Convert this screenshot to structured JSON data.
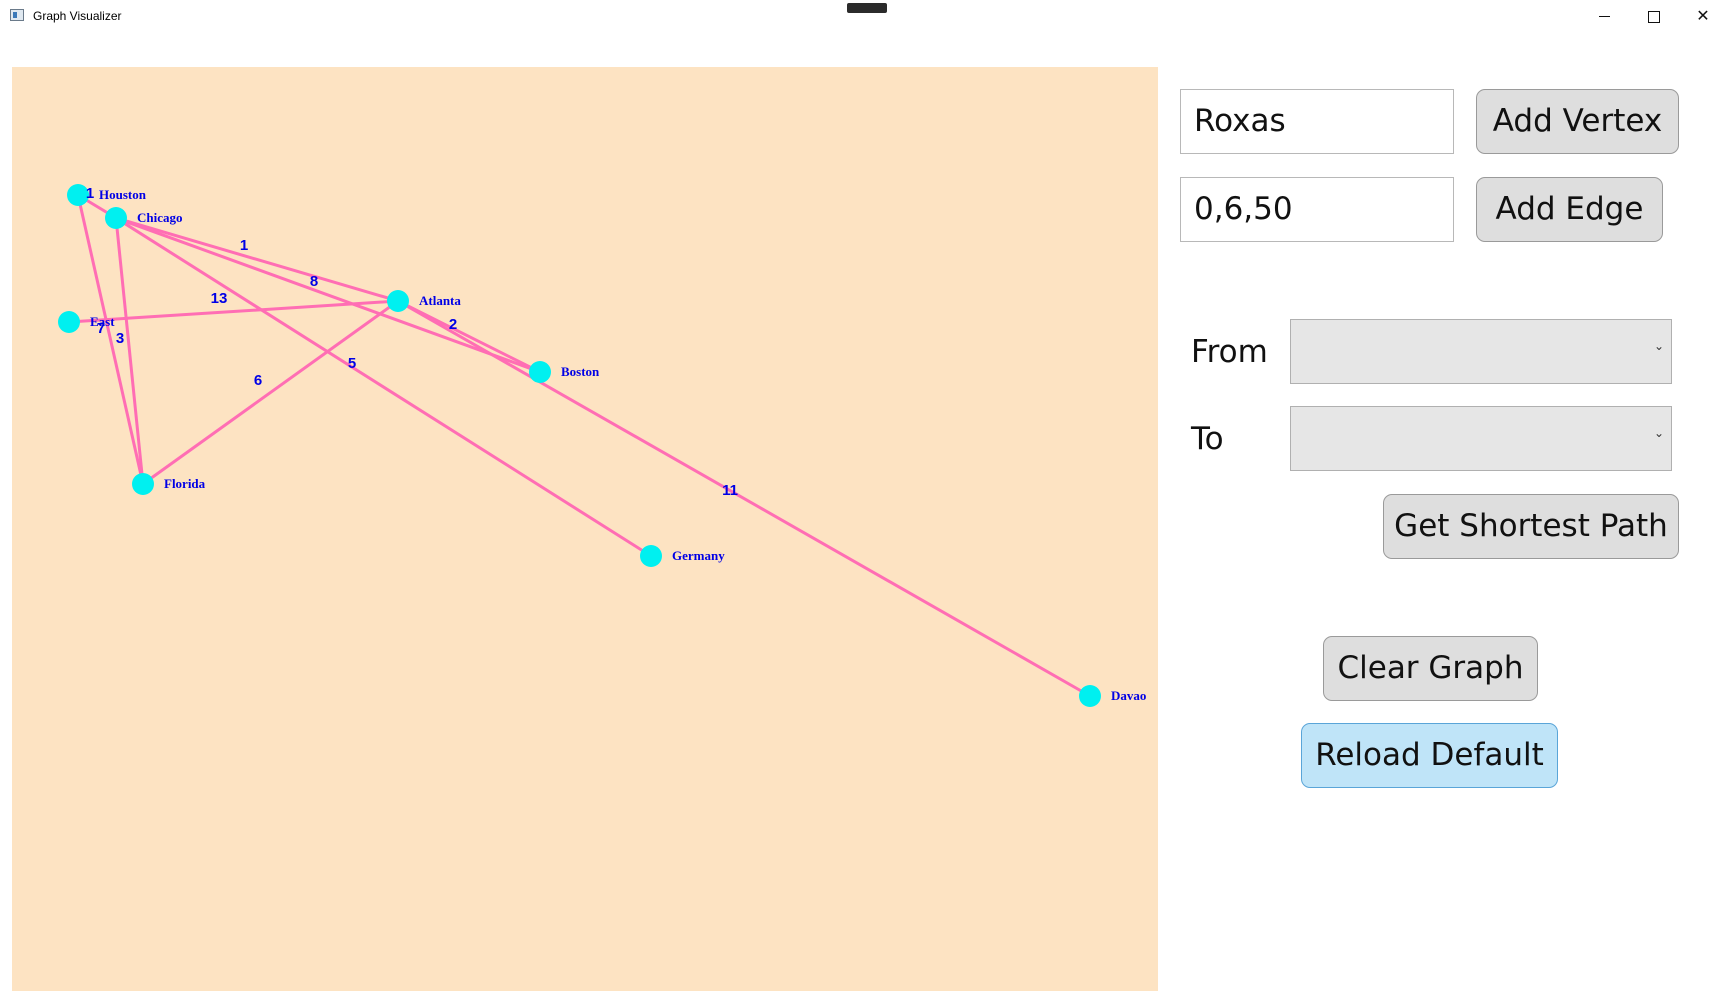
{
  "window": {
    "title": "Graph Visualizer",
    "controls": {
      "minimize": "minimize-icon",
      "maximize": "maximize-icon",
      "close": "close-icon"
    }
  },
  "colors": {
    "canvas_bg": "#fde3c2",
    "edge": "#ff6eb4",
    "vertex": "#00f0f0",
    "label": "#0000e6",
    "button_bg": "#dedede",
    "button_hover_bg": "#bfe4f8"
  },
  "graph": {
    "vertices": [
      "Houston",
      "Chicago",
      "Atlanta",
      "East",
      "Boston",
      "Florida",
      "Germany",
      "Davao"
    ],
    "edges": [
      {
        "from": "Houston",
        "to": "Chicago",
        "weight": "1"
      },
      {
        "from": "Chicago",
        "to": "Atlanta",
        "weight": "1"
      },
      {
        "from": "Chicago",
        "to": "Boston",
        "weight": "8"
      },
      {
        "from": "East",
        "to": "Atlanta",
        "weight": "13"
      },
      {
        "from": "Atlanta",
        "to": "Boston",
        "weight": "2"
      },
      {
        "from": "Houston",
        "to": "Florida",
        "weight": "7"
      },
      {
        "from": "Chicago",
        "to": "Florida",
        "weight": "3"
      },
      {
        "from": "Florida",
        "to": "Atlanta",
        "weight": "6"
      },
      {
        "from": "Chicago",
        "to": "Germany",
        "weight": "5"
      },
      {
        "from": "Atlanta",
        "to": "Davao",
        "weight": "11"
      }
    ]
  },
  "panel": {
    "vertex_input_value": "Roxas",
    "add_vertex_label": "Add Vertex",
    "edge_input_value": "0,6,50",
    "add_edge_label": "Add Edge",
    "from_label": "From",
    "from_value": "",
    "to_label": "To",
    "to_value": "",
    "shortest_path_label": "Get Shortest Path",
    "clear_graph_label": "Clear Graph",
    "reload_default_label": "Reload Default"
  }
}
